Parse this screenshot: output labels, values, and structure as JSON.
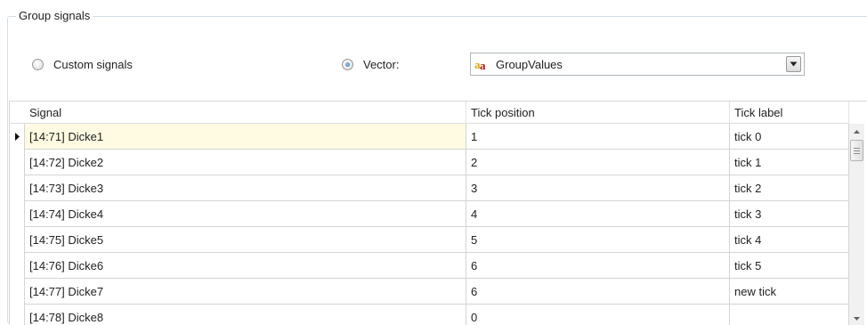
{
  "group": {
    "title": "Group signals"
  },
  "options": {
    "custom_signals_label": "Custom signals",
    "custom_signals_checked": false,
    "vector_label": "Vector:",
    "vector_checked": true
  },
  "vector_combo": {
    "value": "GroupValues",
    "icon": "variable-icon"
  },
  "grid": {
    "columns": [
      "Signal",
      "Tick position",
      "Tick label"
    ],
    "rows": [
      {
        "signal": "[14:71] Dicke1",
        "tick_position": "1",
        "tick_label": "tick 0"
      },
      {
        "signal": "[14:72] Dicke2",
        "tick_position": "2",
        "tick_label": "tick 1"
      },
      {
        "signal": "[14:73] Dicke3",
        "tick_position": "3",
        "tick_label": "tick 2"
      },
      {
        "signal": "[14:74] Dicke4",
        "tick_position": "4",
        "tick_label": "tick 3"
      },
      {
        "signal": "[14:75] Dicke5",
        "tick_position": "5",
        "tick_label": "tick 4"
      },
      {
        "signal": "[14:76] Dicke6",
        "tick_position": "6",
        "tick_label": "tick 5"
      },
      {
        "signal": "[14:77] Dicke7",
        "tick_position": "6",
        "tick_label": "new tick"
      },
      {
        "signal": "[14:78] Dicke8",
        "tick_position": "0",
        "tick_label": ""
      }
    ],
    "current_row": 0
  },
  "colors": {
    "current_row_bg": "#fffbe2",
    "radio_checked": "#2b6cb0"
  }
}
